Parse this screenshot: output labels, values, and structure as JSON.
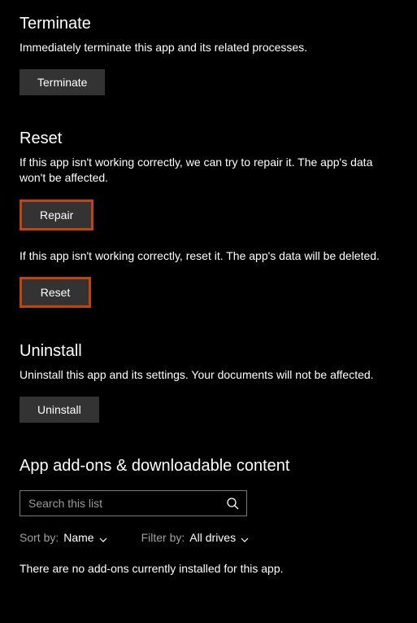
{
  "terminate": {
    "heading": "Terminate",
    "desc": "Immediately terminate this app and its related processes.",
    "button": "Terminate"
  },
  "reset": {
    "heading": "Reset",
    "repair_desc": "If this app isn't working correctly, we can try to repair it. The app's data won't be affected.",
    "repair_button": "Repair",
    "reset_desc": "If this app isn't working correctly, reset it. The app's data will be deleted.",
    "reset_button": "Reset"
  },
  "uninstall": {
    "heading": "Uninstall",
    "desc": "Uninstall this app and its settings. Your documents will not be affected.",
    "button": "Uninstall"
  },
  "addons": {
    "heading": "App add-ons & downloadable content",
    "search_placeholder": "Search this list",
    "sort_label": "Sort by:",
    "sort_value": "Name",
    "filter_label": "Filter by:",
    "filter_value": "All drives",
    "empty_msg": "There are no add-ons currently installed for this app."
  },
  "highlight_color": "#c1440e"
}
